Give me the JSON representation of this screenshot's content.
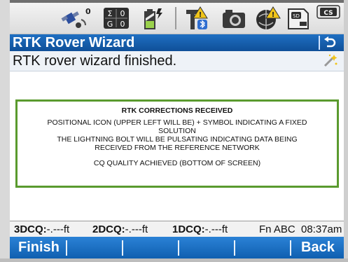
{
  "window": {
    "title": "RTK Rover Wizard",
    "message": "RTK rover wizard finished."
  },
  "status_icons": [
    {
      "name": "gps-satellite-icon",
      "value": "0"
    },
    {
      "name": "sigma-grid-icon",
      "row1_a": "Σ",
      "row1_b": "0",
      "row2_a": "G",
      "row2_b": "0"
    },
    {
      "name": "battery-lightning-icon"
    },
    {
      "name": "radio-tower-bluetooth-warning-icon"
    },
    {
      "name": "camera-icon"
    },
    {
      "name": "globe-warning-icon"
    },
    {
      "name": "sd-card-icon",
      "value": "SD"
    },
    {
      "name": "cs-key-icon",
      "value": "CS"
    }
  ],
  "note": {
    "heading": "RTK CORRECTIONS RECEIVED",
    "line1": "POSITIONAL ICON (UPPER LEFT WILL BE) + SYMBOL INDICATING A FIXED",
    "line2": "SOLUTION",
    "line3": "THE LIGHTNING BOLT WILL BE PULSATING INDICATING DATA BEING",
    "line4": "RECEIVED FROM THE REFERENCE NETWORK",
    "line5": "CQ QUALITY ACHIEVED (BOTTOM OF SCREEN)"
  },
  "infobar": {
    "dcq3_label": "3DCQ:",
    "dcq3_value": "-.---ft",
    "dcq2_label": "2DCQ:",
    "dcq2_value": "-.---ft",
    "dcq1_label": "1DCQ:",
    "dcq1_value": "-.---ft",
    "mode": "Fn ABC",
    "time": "08:37am"
  },
  "softkeys": {
    "finish": "Finish",
    "back": "Back"
  },
  "colors": {
    "title_blue": "#1567b8",
    "note_border": "#5a9a2e",
    "softkey_blue": "#1a6fc4"
  }
}
